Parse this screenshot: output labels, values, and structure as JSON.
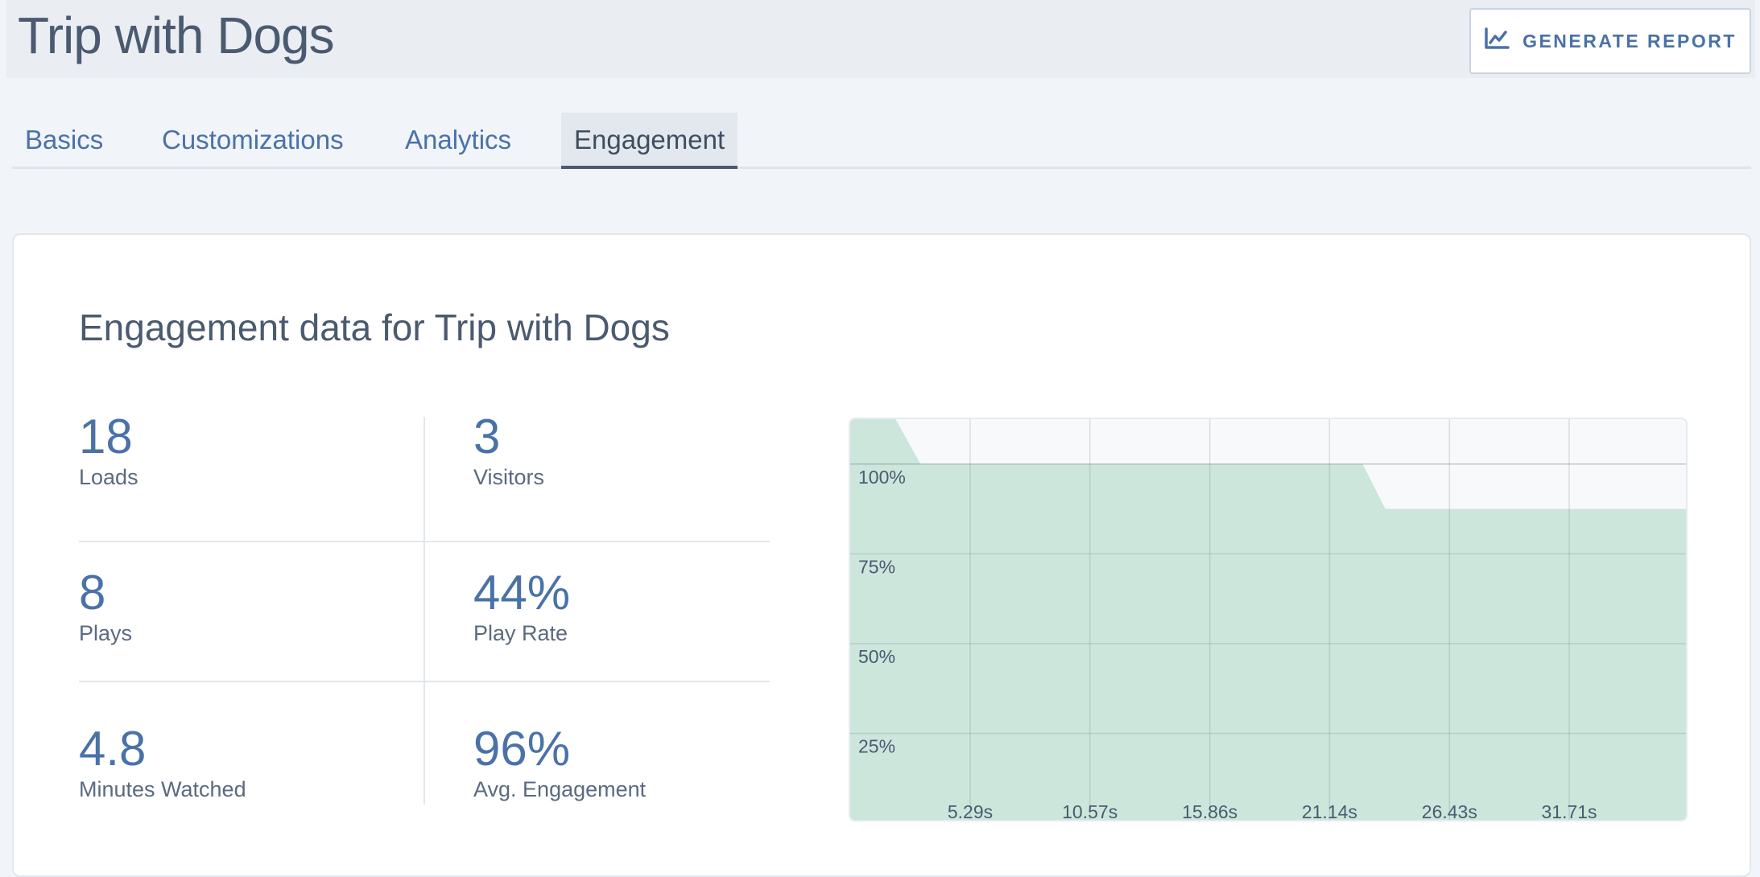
{
  "page": {
    "title": "Trip with Dogs",
    "report_button_label": "GENERATE REPORT"
  },
  "tabs": [
    {
      "label": "Basics",
      "active": false
    },
    {
      "label": "Customizations",
      "active": false
    },
    {
      "label": "Analytics",
      "active": false
    },
    {
      "label": "Engagement",
      "active": true
    }
  ],
  "card": {
    "heading": "Engagement data for Trip with Dogs",
    "stats": [
      {
        "value": "18",
        "label": "Loads"
      },
      {
        "value": "3",
        "label": "Visitors"
      },
      {
        "value": "8",
        "label": "Plays"
      },
      {
        "value": "44%",
        "label": "Play Rate"
      },
      {
        "value": "4.8",
        "label": "Minutes Watched"
      },
      {
        "value": "96%",
        "label": "Avg. Engagement"
      }
    ]
  },
  "colors": {
    "accent": "#4a72a8",
    "chart_fill": "#cde6dc",
    "chart_bg": "#f7f9fb"
  },
  "chart_data": {
    "type": "area",
    "x_tick_labels": [
      "5.29s",
      "10.57s",
      "15.86s",
      "21.14s",
      "26.43s",
      "31.71s"
    ],
    "y_tick_labels": [
      "100%",
      "75%",
      "50%",
      "25%"
    ],
    "x_ticks": [
      5.29,
      10.57,
      15.86,
      21.14,
      26.43,
      31.71
    ],
    "y_ticks": [
      100,
      75,
      50,
      25
    ],
    "xlim": [
      0,
      37
    ],
    "ylim": [
      0,
      112.5
    ],
    "grid": true,
    "series": [
      {
        "x": [
          0,
          2.0,
          3.1,
          22.6,
          23.6,
          37
        ],
        "y": [
          112.5,
          112.5,
          100,
          100,
          87.5,
          87.5
        ]
      }
    ]
  }
}
